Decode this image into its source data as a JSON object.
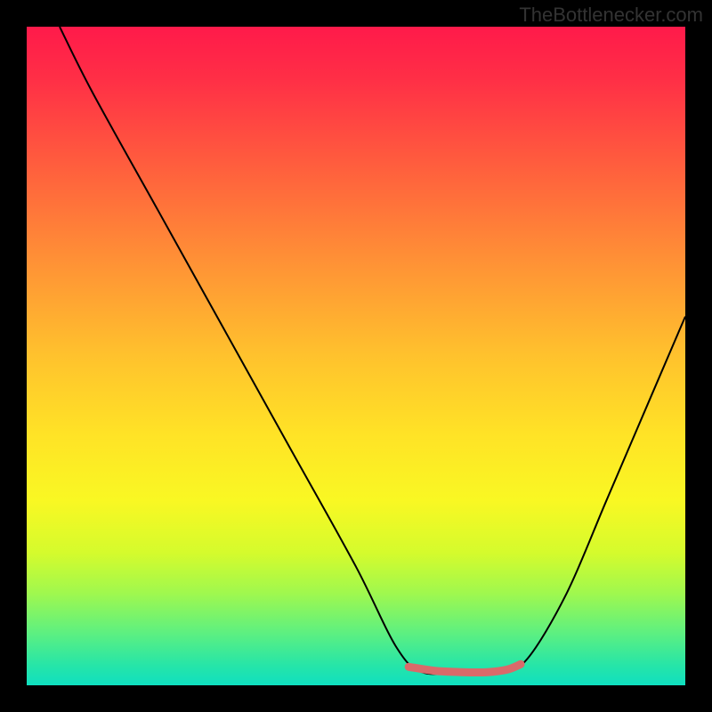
{
  "watermark": "TheBottlenecker.com",
  "chart_data": {
    "type": "line",
    "title": "",
    "xlabel": "",
    "ylabel": "",
    "xlim": [
      0,
      100
    ],
    "ylim": [
      0,
      100
    ],
    "grid": false,
    "background_gradient": {
      "stops": [
        {
          "offset": 0.0,
          "color": "#ff1a4a"
        },
        {
          "offset": 0.08,
          "color": "#ff2f46"
        },
        {
          "offset": 0.2,
          "color": "#ff5a3e"
        },
        {
          "offset": 0.35,
          "color": "#ff8f36"
        },
        {
          "offset": 0.5,
          "color": "#ffc22d"
        },
        {
          "offset": 0.62,
          "color": "#ffe326"
        },
        {
          "offset": 0.72,
          "color": "#f9f823"
        },
        {
          "offset": 0.8,
          "color": "#d4fb2d"
        },
        {
          "offset": 0.86,
          "color": "#a0f84e"
        },
        {
          "offset": 0.92,
          "color": "#5ef080"
        },
        {
          "offset": 0.97,
          "color": "#26e5a8"
        },
        {
          "offset": 1.0,
          "color": "#0fdfc0"
        }
      ]
    },
    "series": [
      {
        "name": "bottleneck-curve",
        "color": "#000000",
        "width": 2,
        "points": [
          {
            "x": 5,
            "y": 100
          },
          {
            "x": 10,
            "y": 90
          },
          {
            "x": 20,
            "y": 72
          },
          {
            "x": 30,
            "y": 54
          },
          {
            "x": 40,
            "y": 36
          },
          {
            "x": 50,
            "y": 18
          },
          {
            "x": 56,
            "y": 6
          },
          {
            "x": 60,
            "y": 2
          },
          {
            "x": 66,
            "y": 2
          },
          {
            "x": 72,
            "y": 2
          },
          {
            "x": 76,
            "y": 4
          },
          {
            "x": 82,
            "y": 14
          },
          {
            "x": 88,
            "y": 28
          },
          {
            "x": 94,
            "y": 42
          },
          {
            "x": 100,
            "y": 56
          }
        ]
      },
      {
        "name": "sweet-spot-band",
        "color": "#d96a6a",
        "width": 9,
        "points": [
          {
            "x": 58,
            "y": 2.8
          },
          {
            "x": 62,
            "y": 2.2
          },
          {
            "x": 66,
            "y": 2.0
          },
          {
            "x": 70,
            "y": 2.0
          },
          {
            "x": 73,
            "y": 2.4
          },
          {
            "x": 75,
            "y": 3.2
          }
        ]
      }
    ]
  }
}
